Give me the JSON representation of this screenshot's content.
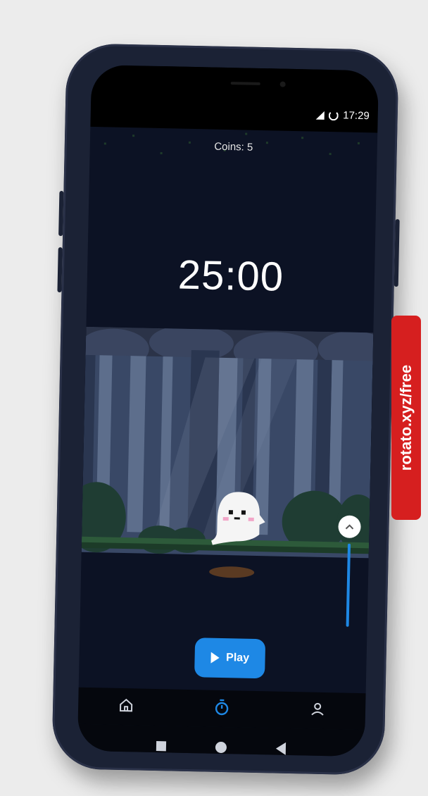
{
  "status": {
    "time": "17:29"
  },
  "game": {
    "coins_label": "Coins: 5",
    "timer": "25:00",
    "play_label": "Play"
  },
  "nav": {
    "items": [
      {
        "icon": "home-icon",
        "active": false
      },
      {
        "icon": "timer-icon",
        "active": true
      },
      {
        "icon": "profile-icon",
        "active": false
      }
    ]
  },
  "colors": {
    "accent": "#1e88e5",
    "background": "#0c1224",
    "watermark": "#d61f1f"
  },
  "watermark": {
    "text": "rotato.xyz/free"
  }
}
